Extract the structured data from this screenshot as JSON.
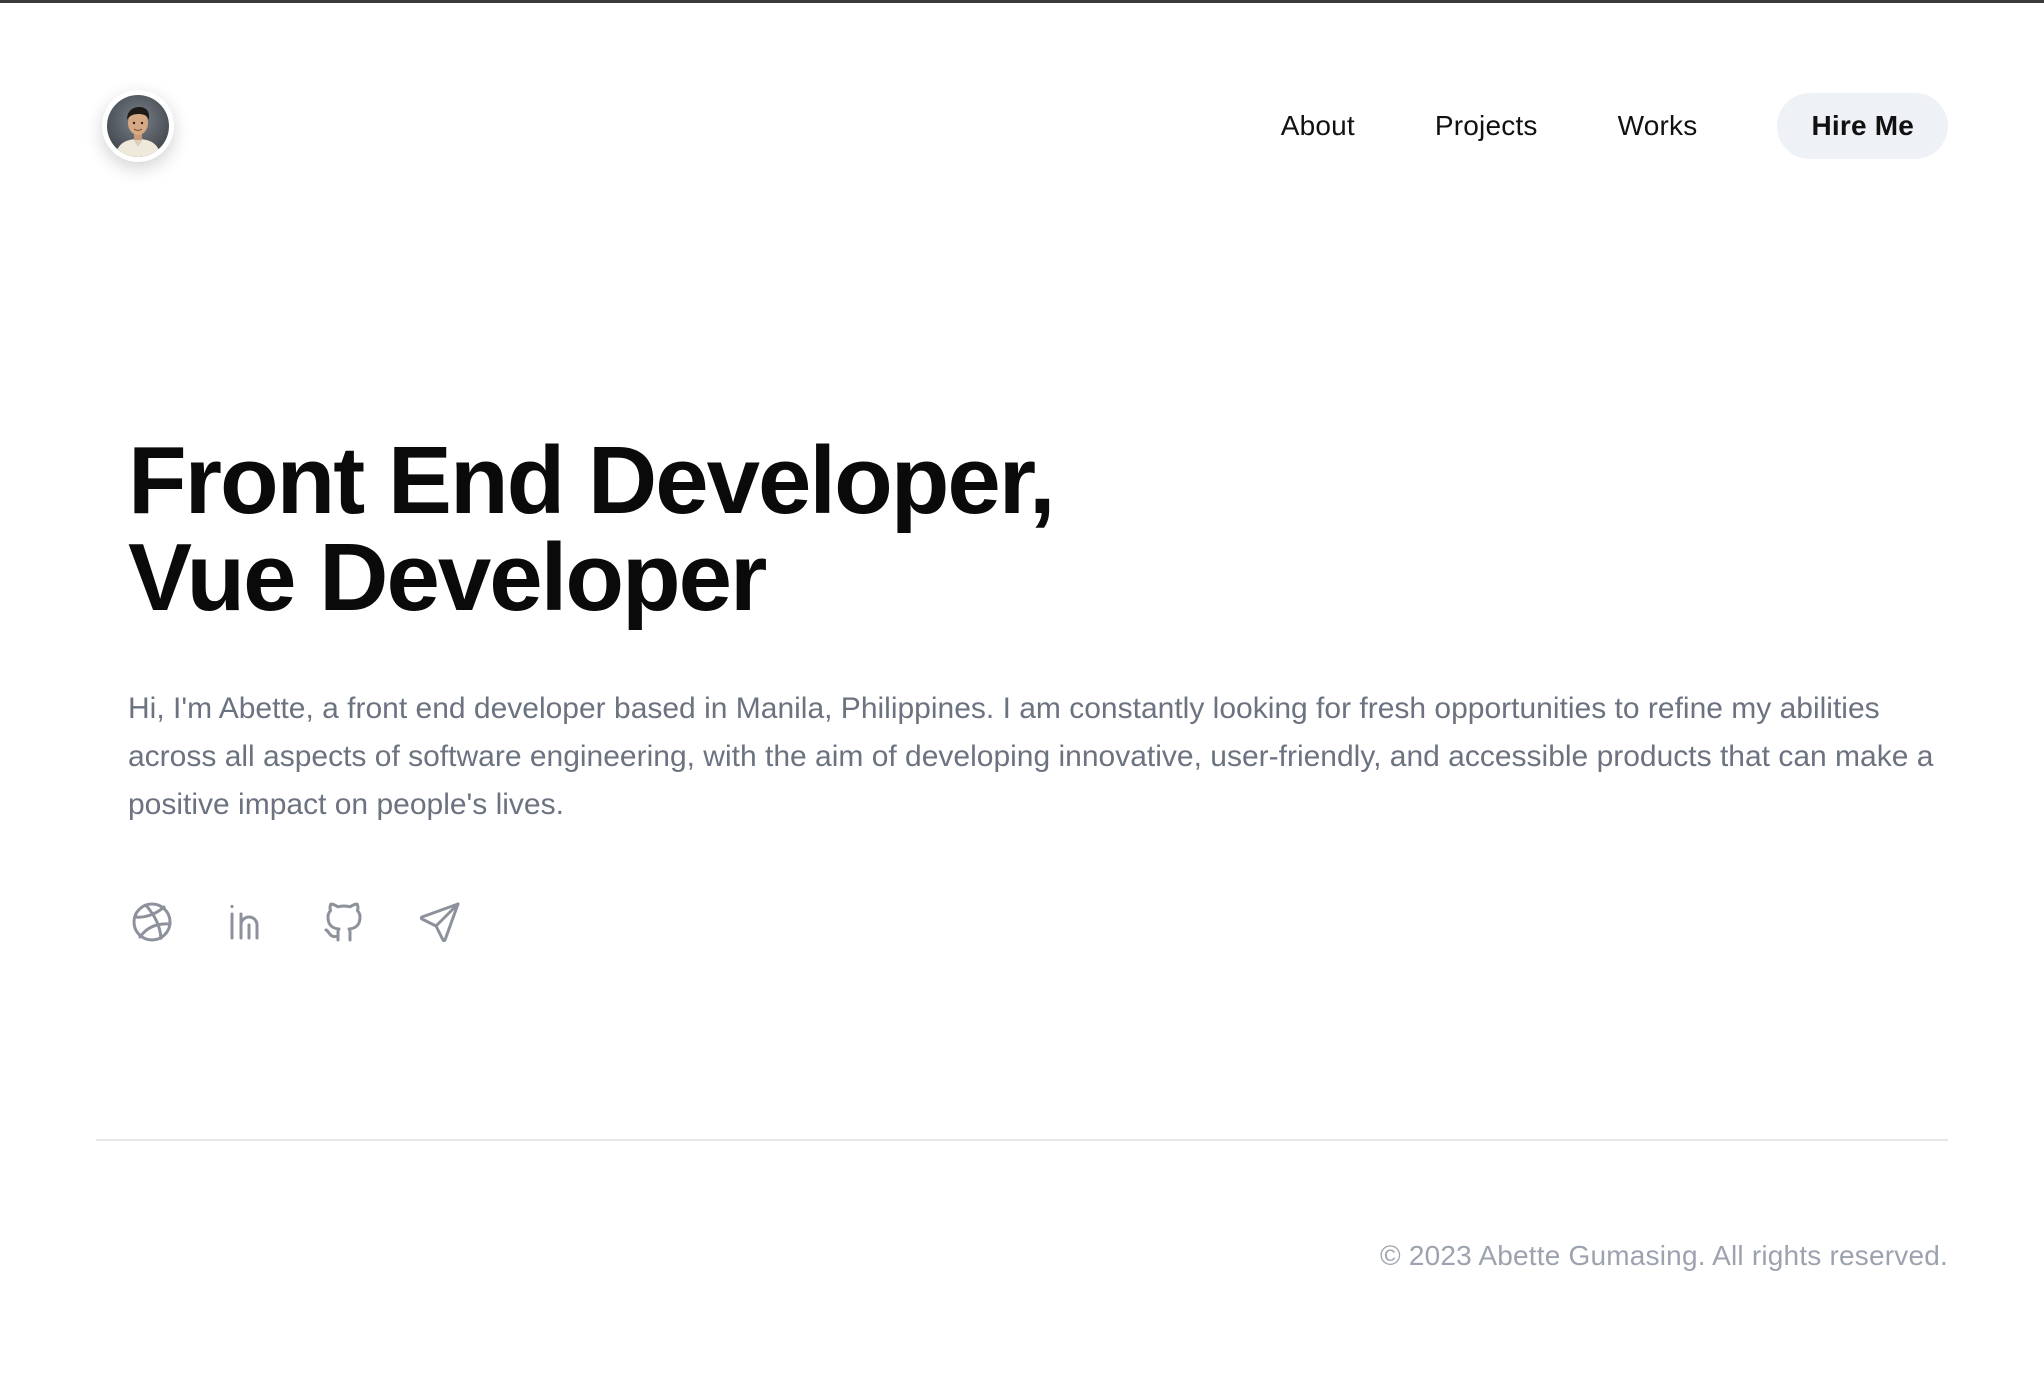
{
  "colors": {
    "accent_bg": "#eef2f7",
    "text_primary": "#0a0a0a",
    "text_muted": "#6b7280",
    "icon": "#8c919b",
    "footer": "#9ca3af"
  },
  "header": {
    "avatar_icon": "profile-photo",
    "nav": [
      {
        "label": "About"
      },
      {
        "label": "Projects"
      },
      {
        "label": "Works"
      }
    ],
    "cta_label": "Hire Me"
  },
  "hero": {
    "title_line1": "Front End Developer,",
    "title_line2": "Vue Developer",
    "description": "Hi, I'm Abette, a front end developer based in Manila, Philippines. I am constantly looking for fresh opportunities to refine my abilities across all aspects of software engineering, with the aim of developing innovative, user-friendly, and accessible products that can make a positive impact on people's lives."
  },
  "socials": [
    {
      "icon": "dribbble-icon"
    },
    {
      "icon": "linkedin-icon"
    },
    {
      "icon": "github-icon"
    },
    {
      "icon": "send-icon"
    }
  ],
  "footer": {
    "copyright": "© 2023 Abette Gumasing. All rights reserved."
  }
}
